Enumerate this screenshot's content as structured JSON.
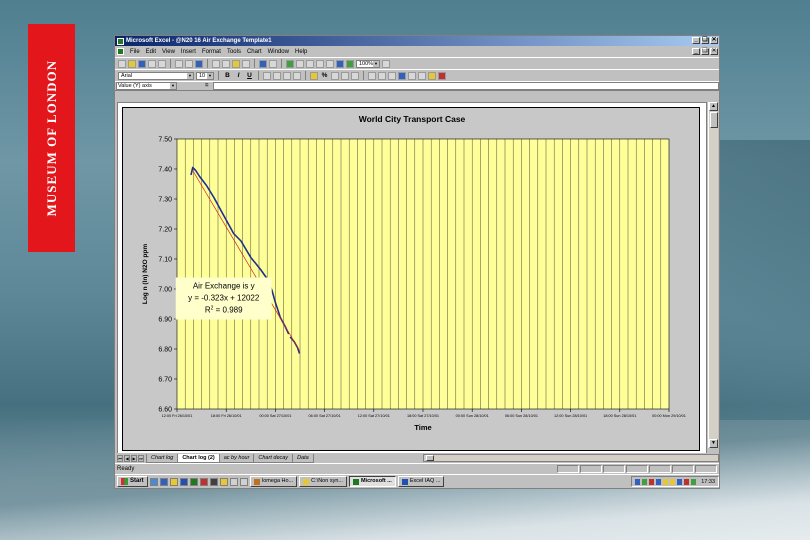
{
  "background": {
    "banner_text": "MUSEUM OF LONDON",
    "banner_color": "#e3161c"
  },
  "window": {
    "title": "Microsoft Excel - @N20 16 Air Exchange Template1",
    "title_controls": [
      "_",
      "❑",
      "✕"
    ],
    "doc_controls": [
      "_",
      "❑",
      "✕"
    ]
  },
  "menu": {
    "items": [
      "File",
      "Edit",
      "View",
      "Insert",
      "Format",
      "Tools",
      "Chart",
      "Window",
      "Help"
    ]
  },
  "toolbar": {
    "zoom": "100%",
    "font_name": "Arial",
    "font_size": "10",
    "bold": "B",
    "italic": "I",
    "underline": "U",
    "percent": "%"
  },
  "formula_bar": {
    "name_box": "Value (Y) axis",
    "equals": "="
  },
  "chart_data": {
    "type": "line",
    "title": "World City Transport Case",
    "xlabel": "Time",
    "ylabel": "Log n (ln) N2O ppm",
    "ylim": [
      6.6,
      7.5
    ],
    "yticks": [
      "7.50",
      "7.40",
      "7.30",
      "7.20",
      "7.10",
      "7.00",
      "6.90",
      "6.80",
      "6.70",
      "6.60"
    ],
    "xticks": [
      "12:00 Fri 26/10/01",
      "18:00 Fri 26/10/01",
      "00:00 Sat 27/10/01",
      "06:00 Sat 27/10/01",
      "12:00 Sat 27/10/01",
      "18:00 Sat 27/10/01",
      "00:00 Sun 28/10/01",
      "06:00 Sun 28/10/01",
      "12:00 Sun 28/10/01",
      "18:00 Sun 28/10/01",
      "00:00 Mon 29/10/01"
    ],
    "grid": true,
    "plot_bg": "#ffff99",
    "series": [
      {
        "color": "#1f2f8f",
        "x": [
          0.285,
          0.32,
          0.38,
          0.46,
          0.6,
          0.75,
          0.85,
          0.95,
          1.05,
          1.15,
          1.3,
          1.5,
          1.7,
          1.85,
          1.93,
          2.0,
          2.05,
          2.1,
          2.2,
          2.27
        ],
        "y": [
          7.38,
          7.405,
          7.395,
          7.375,
          7.345,
          7.305,
          7.275,
          7.245,
          7.215,
          7.185,
          7.16,
          7.105,
          7.065,
          7.03,
          6.995,
          6.955,
          6.93,
          6.905,
          6.875,
          6.85
        ]
      },
      {
        "color": "#1f2f8f",
        "x": [
          2.3,
          2.38,
          2.45,
          2.49
        ],
        "y": [
          6.84,
          6.825,
          6.805,
          6.785
        ]
      },
      {
        "color": "#cc2222",
        "x": [
          0.32,
          2.49
        ],
        "y": [
          7.395,
          6.795
        ]
      }
    ],
    "annotations": {
      "line1": "Air Exchange is y",
      "line2": "y = -0.323x + 12022",
      "line3_prefix": "R",
      "line3_sup": "2",
      "line3_suffix": " = 0.989"
    }
  },
  "sheet_tabs": {
    "nav": [
      "⏮",
      "◀",
      "▶",
      "⏭"
    ],
    "tabs": [
      "Chart log",
      "Chart log (2)",
      "ac by hour",
      "Chart decay",
      "Data"
    ]
  },
  "status": {
    "text": "Ready"
  },
  "taskbar": {
    "start": "Start",
    "tasks": [
      "Iomega Ho...",
      "C:\\Non syn...",
      "Microsoft ...",
      "Excel IAQ ..."
    ],
    "clock": "17:33"
  }
}
